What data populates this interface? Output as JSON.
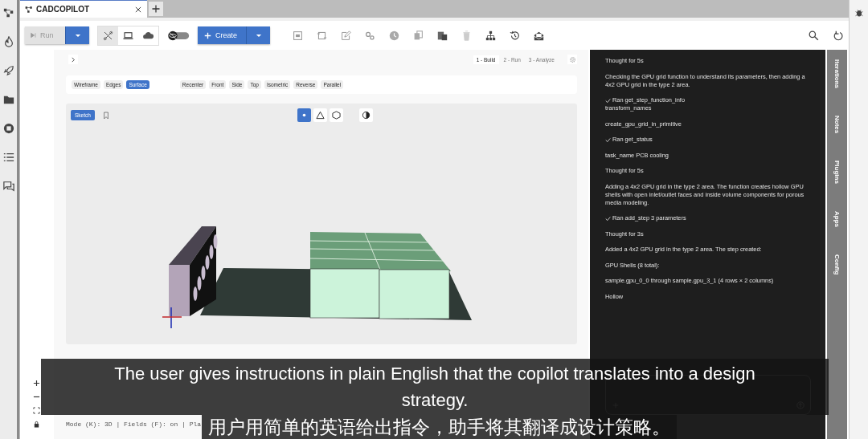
{
  "tabs": [
    {
      "label": "CADCOPILOT",
      "selected": true
    }
  ],
  "toolbar": {
    "run_button": "Run",
    "create_button": "Create"
  },
  "steps": [
    {
      "label": "1 - Build",
      "selected": true
    },
    {
      "label": "2 - Run",
      "selected": false
    },
    {
      "label": "3 - Analyze",
      "selected": false
    }
  ],
  "render_modes": [
    {
      "label": "Wireframe",
      "selected": false
    },
    {
      "label": "Edges",
      "selected": false
    },
    {
      "label": "Surface",
      "selected": true
    }
  ],
  "view_buttons": [
    "Recenter",
    "Front",
    "Side",
    "Top",
    "Isometric",
    "Reverse",
    "Parallel"
  ],
  "sketch_button": "Sketch",
  "selection_modes": [
    {
      "kind": "point",
      "selected": true
    },
    {
      "kind": "triangle",
      "selected": false
    },
    {
      "kind": "hexagon",
      "selected": false
    }
  ],
  "status_text": "Mode (K): 3D | Fields (F): on | Pla",
  "chat": {
    "messages": [
      {
        "kind": "thought",
        "text": "Thought for 5s"
      },
      {
        "kind": "text",
        "text": "Checking the GPU grid function to understand its parameters, then adding a 4x2 GPU grid in the type 2 area."
      },
      {
        "kind": "tool",
        "text": "Ran get_step_function_info",
        "detail": "transform_names"
      },
      {
        "kind": "text",
        "text": "create_gpu_grid_in_primitive"
      },
      {
        "kind": "tool",
        "text": "Ran get_status"
      },
      {
        "kind": "text",
        "text": "task_name PCB cooling"
      },
      {
        "kind": "thought",
        "text": "Thought for 5s"
      },
      {
        "kind": "text",
        "text": "Adding a 4x2 GPU grid in the type 2 area. The function creates hollow GPU shells with open inlet/outlet faces and inside volume components for porous media modeling."
      },
      {
        "kind": "tool",
        "text": "Ran add_step 3 parameters"
      },
      {
        "kind": "thought",
        "text": "Thought for 3s"
      },
      {
        "kind": "text",
        "text": "Added a 4x2 GPU grid in the type 2 area. The step created:"
      },
      {
        "kind": "text",
        "text": "GPU Shells (8 total):"
      },
      {
        "kind": "text",
        "text": "sample.gpu_0_0 through sample.gpu_3_1 (4 rows × 2 columns)"
      },
      {
        "kind": "text",
        "text": "Hollow"
      }
    ]
  },
  "side_tabs": [
    "Iterations",
    "Notes",
    "Plugins",
    "Apps",
    "Config"
  ],
  "subtitle": {
    "english": "The user gives instructions in plain English that  the copilot translates into a design strategy.",
    "chinese": "用户用简单的英语给出指令，助手将其翻译成设计策略。"
  }
}
